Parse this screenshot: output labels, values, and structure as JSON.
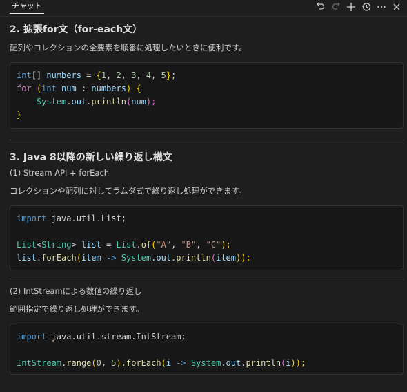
{
  "panel": {
    "tab_label": "チャット"
  },
  "toolbar": {
    "undo_icon": "undo-icon",
    "redo_icon": "redo-icon",
    "new_chat_icon": "plus-icon",
    "history_icon": "history-icon",
    "more_icon": "more-icon",
    "close_icon": "close-icon"
  },
  "sections": {
    "s2": {
      "title": "2. 拡張for文（for-each文）",
      "desc": "配列やコレクションの全要素を順番に処理したいときに便利です。",
      "code": {
        "l1": {
          "a": "int",
          "b": "[]",
          "c": " numbers",
          "d": " = ",
          "e": "{",
          "f": "1",
          "g": ", ",
          "h": "2",
          "i": ", ",
          "j": "3",
          "k": ", ",
          "l": "4",
          "m": ", ",
          "n": "5",
          "o": "}",
          "p": ";"
        },
        "l2": {
          "a": "for",
          "b": " (",
          "c": "int",
          "d": " num",
          "e": " : ",
          "f": "numbers",
          "g": ") ",
          "h": "{"
        },
        "l3": {
          "a": "    System",
          "b": ".",
          "c": "out",
          "d": ".",
          "e": "println",
          "f": "(",
          "g": "num",
          "h": ");"
        },
        "l4": {
          "a": "}"
        }
      }
    },
    "s3": {
      "title": "3. Java 8以降の新しい繰り返し構文",
      "sub1": "(1) Stream API + forEach",
      "desc1": "コレクションや配列に対してラムダ式で繰り返し処理ができます。",
      "code1": {
        "l1": {
          "a": "import",
          "b": " java.util.List;"
        },
        "l3": {
          "a": "List",
          "b": "<",
          "c": "String",
          "d": ">",
          "e": " list",
          "f": " = ",
          "g": "List",
          "h": ".",
          "i": "of",
          "j": "(",
          "k": "\"A\"",
          "l": ", ",
          "m": "\"B\"",
          "n": ", ",
          "o": "\"C\"",
          "p": ");"
        },
        "l4": {
          "a": "list",
          "b": ".",
          "c": "forEach",
          "d": "(",
          "e": "item",
          "f": " -> ",
          "g": "System",
          "h": ".",
          "i": "out",
          "j": ".",
          "k": "println",
          "l": "(",
          "m": "item",
          "n": "));"
        }
      },
      "sub2": "(2) IntStreamによる数値の繰り返し",
      "desc2": "範囲指定で繰り返し処理ができます。",
      "code2": {
        "l1": {
          "a": "import",
          "b": " java.util.stream.IntStream;"
        },
        "l3": {
          "a": "IntStream",
          "b": ".",
          "c": "range",
          "d": "(",
          "e": "0",
          "f": ", ",
          "g": "5",
          "h": ").",
          "i": "forEach",
          "j": "(",
          "k": "i",
          "l": " -> ",
          "m": "System",
          "n": ".",
          "o": "out",
          "p": ".",
          "q": "println",
          "r": "(",
          "s": "i",
          "t": "));"
        }
      }
    }
  },
  "colors": {
    "background": "#1e1e1e",
    "code_background": "#181818",
    "keyword": "#569cd6",
    "type": "#4ec9b0",
    "variable": "#9cdcfe",
    "number": "#b5cea8",
    "string": "#ce9178",
    "function": "#dcdcaa",
    "control": "#c586c0"
  }
}
